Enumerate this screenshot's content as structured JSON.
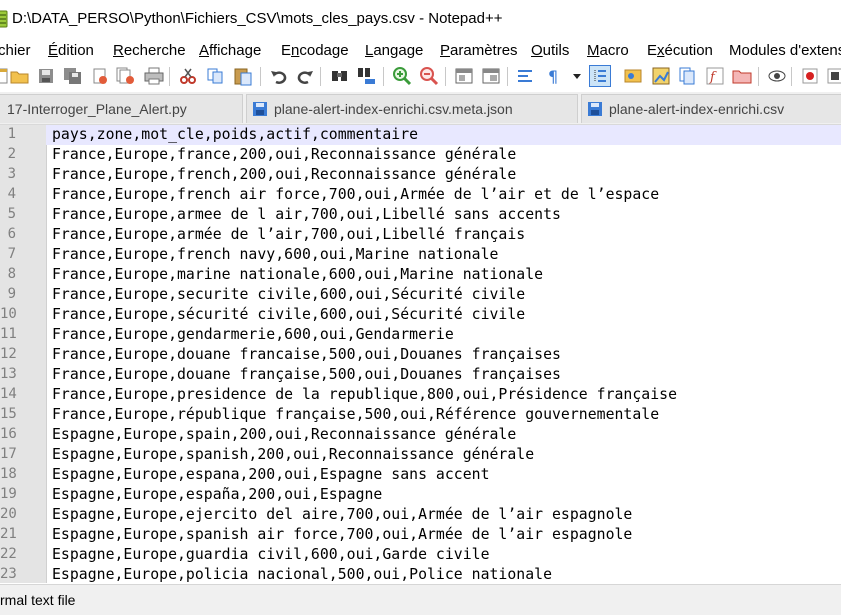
{
  "window": {
    "title": "D:\\DATA_PERSO\\Python\\Fichiers_CSV\\mots_cles_pays.csv - Notepad++"
  },
  "menu": [
    {
      "label": "chier"
    },
    {
      "label": "Édition",
      "mnemonic": "É",
      "rest": "dition"
    },
    {
      "label": "Recherche",
      "mnemonic": "R",
      "rest": "echerche"
    },
    {
      "label": "Affichage",
      "mnemonic": "A",
      "rest": "ffichage"
    },
    {
      "label": "Encodage",
      "mnemonic": "n",
      "pre": "E",
      "rest": "codage"
    },
    {
      "label": "Langage",
      "mnemonic": "L",
      "rest": "angage"
    },
    {
      "label": "Paramètres",
      "mnemonic": "P",
      "rest": "aramètres"
    },
    {
      "label": "Outils",
      "mnemonic": "O",
      "rest": "utils"
    },
    {
      "label": "Macro",
      "mnemonic": "M",
      "rest": "acro"
    },
    {
      "label": "Exécution",
      "mnemonic": "x",
      "pre": "E",
      "rest": "écution"
    },
    {
      "label": "Modules d'extens"
    }
  ],
  "toolbar": {
    "icons": [
      "new-file-icon",
      "open-file-icon",
      "save-icon",
      "save-all-icon",
      "close-icon",
      "close-all-icon",
      "print-icon",
      "cut-icon",
      "copy-icon",
      "paste-icon",
      "undo-icon",
      "redo-icon",
      "find-icon",
      "replace-icon",
      "zoom-in-icon",
      "zoom-out-icon",
      "sync-vertical-icon",
      "sync-horizontal-icon",
      "word-wrap-icon",
      "show-all-chars-icon",
      "dropdown-icon",
      "indent-guide-icon",
      "udl-icon",
      "doc-map-icon",
      "doc-list-icon",
      "function-list-icon",
      "folder-workspace-icon",
      "monitor-icon",
      "record-macro-icon",
      "stop-record-icon"
    ]
  },
  "tabs": [
    {
      "label": "17-Interroger_Plane_Alert.py",
      "active": false
    },
    {
      "label": "plane-alert-index-enrichi.csv.meta.json",
      "active": false
    },
    {
      "label": "plane-alert-index-enrichi.csv",
      "active": false
    }
  ],
  "editor": {
    "current_line": 1,
    "lines": [
      {
        "n": "1",
        "text": "pays,zone,mot_cle,poids,actif,commentaire"
      },
      {
        "n": "2",
        "text": "France,Europe,france,200,oui,Reconnaissance générale"
      },
      {
        "n": "3",
        "text": "France,Europe,french,200,oui,Reconnaissance générale"
      },
      {
        "n": "4",
        "text": "France,Europe,french air force,700,oui,Armée de l’air et de l’espace"
      },
      {
        "n": "5",
        "text": "France,Europe,armee de l air,700,oui,Libellé sans accents"
      },
      {
        "n": "6",
        "text": "France,Europe,armée de l’air,700,oui,Libellé français"
      },
      {
        "n": "7",
        "text": "France,Europe,french navy,600,oui,Marine nationale"
      },
      {
        "n": "8",
        "text": "France,Europe,marine nationale,600,oui,Marine nationale"
      },
      {
        "n": "9",
        "text": "France,Europe,securite civile,600,oui,Sécurité civile"
      },
      {
        "n": "10",
        "text": "France,Europe,sécurité civile,600,oui,Sécurité civile"
      },
      {
        "n": "11",
        "text": "France,Europe,gendarmerie,600,oui,Gendarmerie"
      },
      {
        "n": "12",
        "text": "France,Europe,douane francaise,500,oui,Douanes françaises"
      },
      {
        "n": "13",
        "text": "France,Europe,douane française,500,oui,Douanes françaises"
      },
      {
        "n": "14",
        "text": "France,Europe,presidence de la republique,800,oui,Présidence française"
      },
      {
        "n": "15",
        "text": "France,Europe,république française,500,oui,Référence gouvernementale"
      },
      {
        "n": "16",
        "text": "Espagne,Europe,spain,200,oui,Reconnaissance générale"
      },
      {
        "n": "17",
        "text": "Espagne,Europe,spanish,200,oui,Reconnaissance générale"
      },
      {
        "n": "18",
        "text": "Espagne,Europe,espana,200,oui,Espagne sans accent"
      },
      {
        "n": "19",
        "text": "Espagne,Europe,españa,200,oui,Espagne"
      },
      {
        "n": "20",
        "text": "Espagne,Europe,ejercito del aire,700,oui,Armée de l’air espagnole"
      },
      {
        "n": "21",
        "text": "Espagne,Europe,spanish air force,700,oui,Armée de l’air espagnole"
      },
      {
        "n": "22",
        "text": "Espagne,Europe,guardia civil,600,oui,Garde civile"
      },
      {
        "n": "23",
        "text": "Espagne,Europe,policia nacional,500,oui,Police nationale"
      }
    ]
  },
  "status": {
    "file_type": "rmal text file"
  }
}
